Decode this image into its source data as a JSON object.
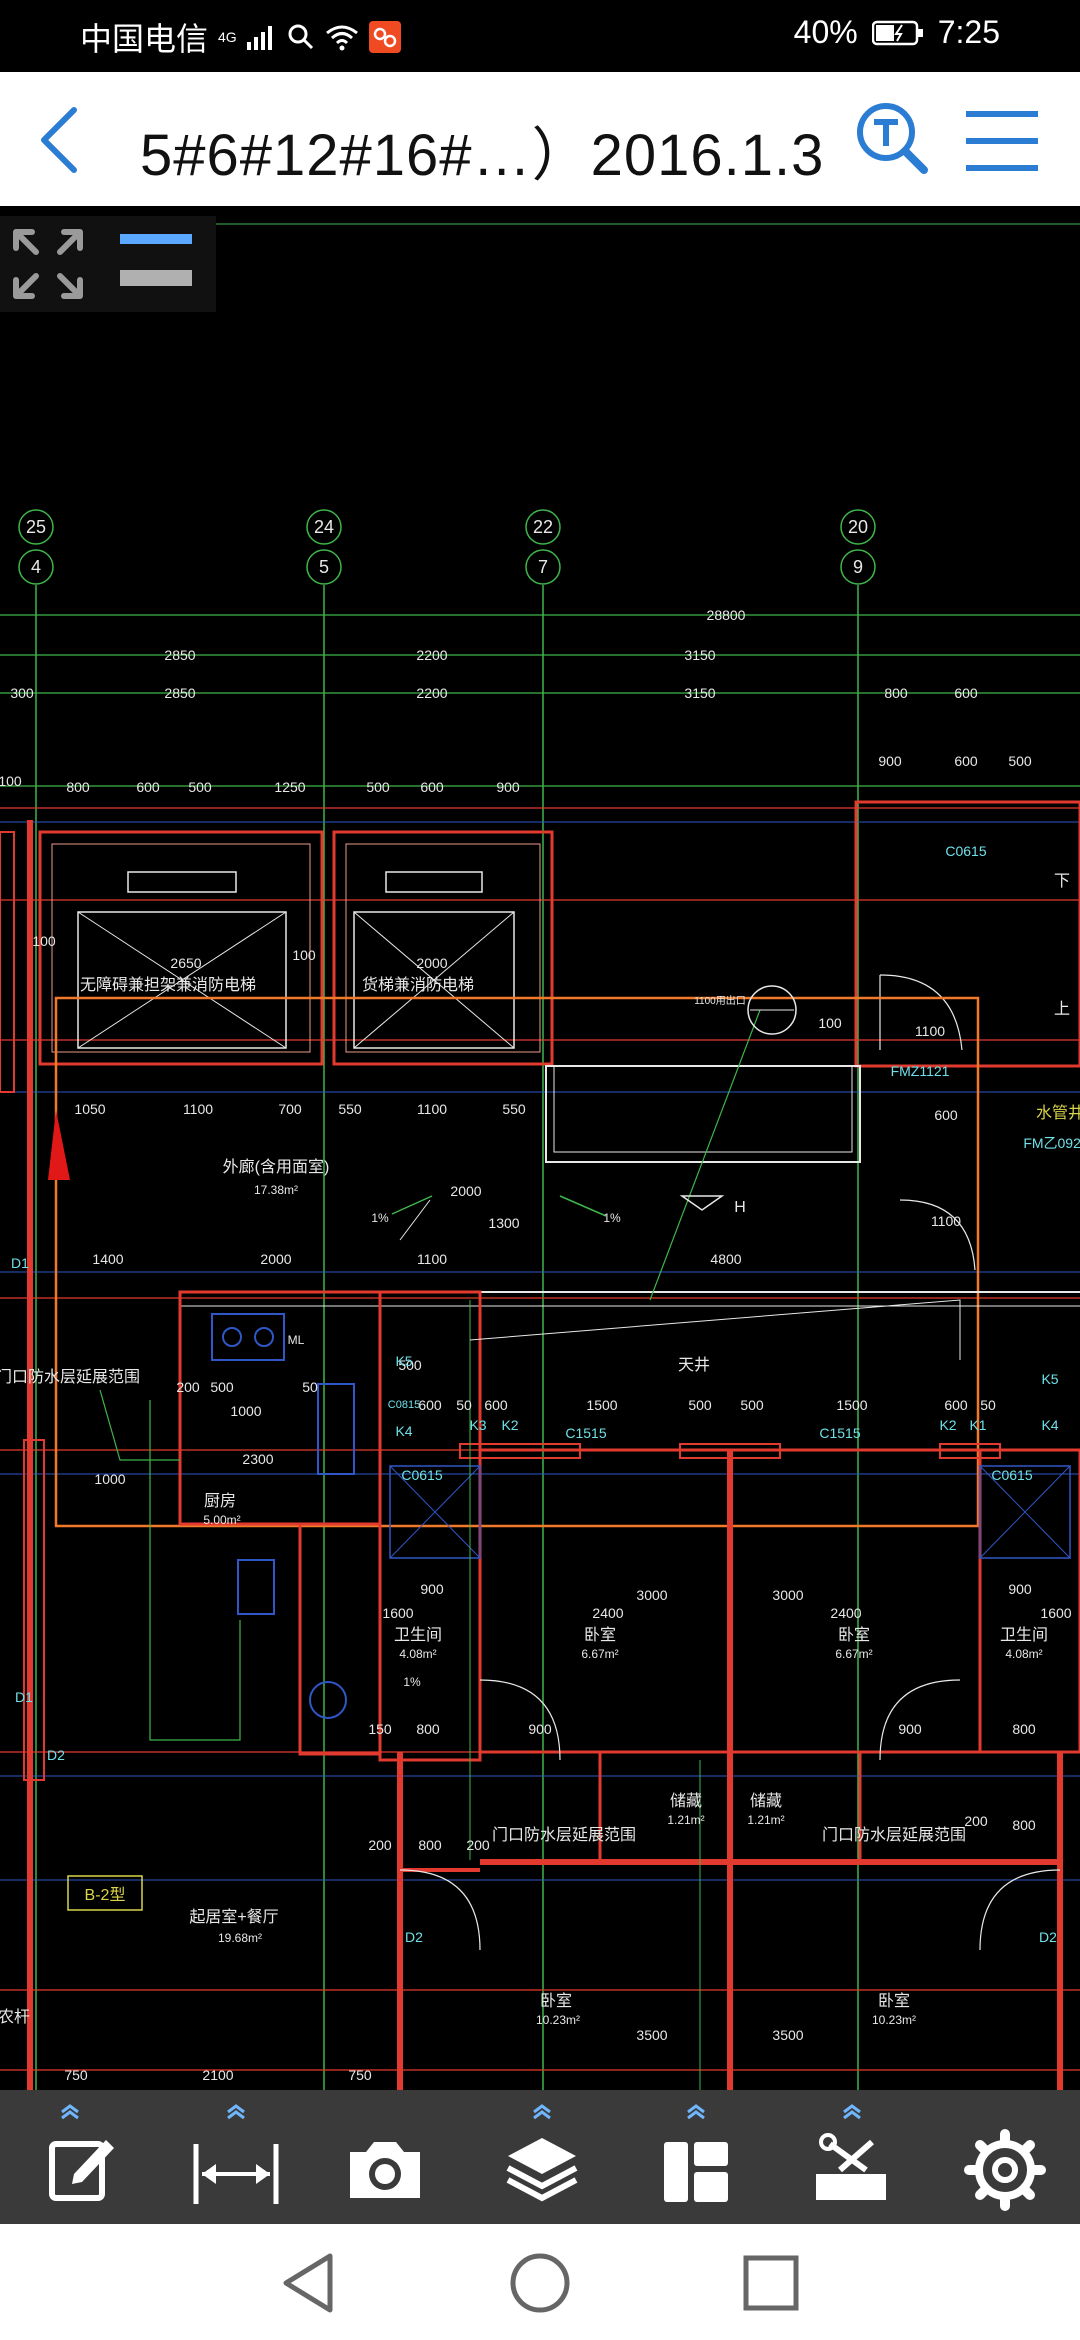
{
  "status": {
    "carrier": "中国电信",
    "network": "4G",
    "battery": "40%",
    "time": "7:25"
  },
  "header": {
    "title": "5#6#12#16#…）2016.1.3"
  },
  "drawing": {
    "axes": [
      {
        "top": "25",
        "bottom": "4"
      },
      {
        "top": "24",
        "bottom": "5"
      },
      {
        "top": "22",
        "bottom": "7"
      },
      {
        "top": "20",
        "bottom": "9"
      }
    ],
    "dims": {
      "overall": "28800",
      "row1": [
        "2850",
        "2200",
        "3150"
      ],
      "row2": [
        "300",
        "2850",
        "2200",
        "3150",
        "800",
        "600"
      ],
      "row3": [
        "100",
        "800",
        "600",
        "500",
        "1250",
        "500",
        "600",
        "900"
      ],
      "row3b": [
        "900",
        "600",
        "500"
      ],
      "row4": [
        "1050",
        "1100",
        "700",
        "550",
        "1100",
        "550"
      ],
      "row5": [
        "1400",
        "2000",
        "1100",
        "4800"
      ],
      "row6": [
        "200",
        "500",
        "1000",
        "50",
        "500",
        "600",
        "50",
        "600",
        "1500",
        "500",
        "500",
        "1500",
        "600",
        "50"
      ],
      "row7": [
        "2400",
        "2400",
        "1600",
        "1600",
        "900",
        "900"
      ],
      "row8": [
        "150",
        "800",
        "900",
        "900",
        "800"
      ],
      "row9": [
        "200",
        "800",
        "200",
        "200",
        "800"
      ],
      "row10": [
        "750",
        "2100",
        "750"
      ],
      "misc": [
        "2650",
        "2000",
        "100",
        "100",
        "1000",
        "2300",
        "3000",
        "3000",
        "3500",
        "3500",
        "1300",
        "2000",
        "1100",
        "600",
        "100",
        "1100"
      ]
    },
    "labels": {
      "elev1": "无障碍兼担架兼消防电梯",
      "elev2": "货梯兼消防电梯",
      "corridor": "外廊(含用面室)",
      "corridor_area": "17.38m²",
      "courtyard": "天井",
      "kitchen": "厨房",
      "kitchen_area": "5.00m²",
      "bath": "卫生间",
      "bath_area": "4.08m²",
      "bedroom": "卧室",
      "bedroom_area": "6.67m²",
      "storage": "储藏",
      "storage_area": "1.21m²",
      "waterproof": "门口防水层延展范围",
      "living": "起居室+餐厅",
      "living_area": "19.68m²",
      "bedroom2": "卧室",
      "bedroom2_area": "10.23m²",
      "tag_b2": "B-2型",
      "pipe": "水管井",
      "window_c0615": "C0615",
      "window_c1515": "C1515",
      "door_fmz": "FMZ1121",
      "door_fm": "FM乙0920",
      "k5": "K5",
      "k4": "K4",
      "k3": "K3",
      "k2": "K2",
      "k1": "K1",
      "d1": "D1",
      "d2": "D2",
      "h": "H",
      "slope": "1%",
      "down": "下",
      "up": "上",
      "ml": "ML",
      "c0815": "C0815",
      "left_cut": "农杆",
      "vent": "1100用出口"
    }
  },
  "toolbar": {
    "items": [
      "edit",
      "measure",
      "camera",
      "layers",
      "layout",
      "tools",
      "settings"
    ]
  },
  "colors": {
    "accent": "#2b7cd3",
    "cad_red": "#e23a2e",
    "cad_green": "#3fb54a",
    "cad_cyan": "#6fe0e8",
    "cad_yellow": "#d9d44a",
    "cad_orange": "#f07a2a"
  }
}
